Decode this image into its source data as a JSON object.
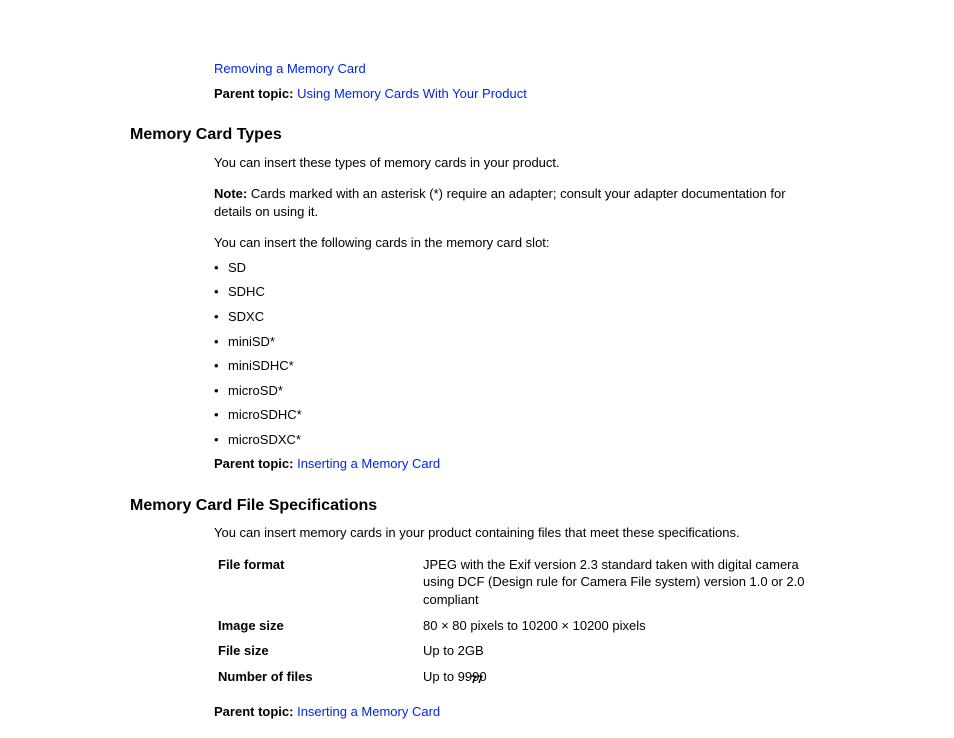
{
  "top_link": "Removing a Memory Card",
  "parent_topic_label": "Parent topic:",
  "parent_topic_1": "Using Memory Cards With Your Product",
  "section1": {
    "heading": "Memory Card Types",
    "intro": "You can insert these types of memory cards in your product.",
    "note_label": "Note:",
    "note_text": " Cards marked with an asterisk (*) require an adapter; consult your adapter documentation for details on using it.",
    "slot_intro": "You can insert the following cards in the memory card slot:",
    "cards": [
      "SD",
      "SDHC",
      "SDXC",
      "miniSD*",
      "miniSDHC*",
      "microSD*",
      "microSDHC*",
      "microSDXC*"
    ],
    "parent_link": "Inserting a Memory Card"
  },
  "section2": {
    "heading": "Memory Card File Specifications",
    "intro": "You can insert memory cards in your product containing files that meet these specifications.",
    "specs": [
      {
        "label": "File format",
        "value": "JPEG with the Exif version 2.3 standard taken with digital camera using DCF (Design rule for Camera File system) version 1.0 or 2.0 compliant"
      },
      {
        "label": "Image size",
        "value": "80 × 80 pixels to 10200 × 10200 pixels"
      },
      {
        "label": "File size",
        "value": "Up to 2GB"
      },
      {
        "label": "Number of files",
        "value": "Up to 9990"
      }
    ],
    "parent_link": "Inserting a Memory Card"
  },
  "page_number": "77"
}
